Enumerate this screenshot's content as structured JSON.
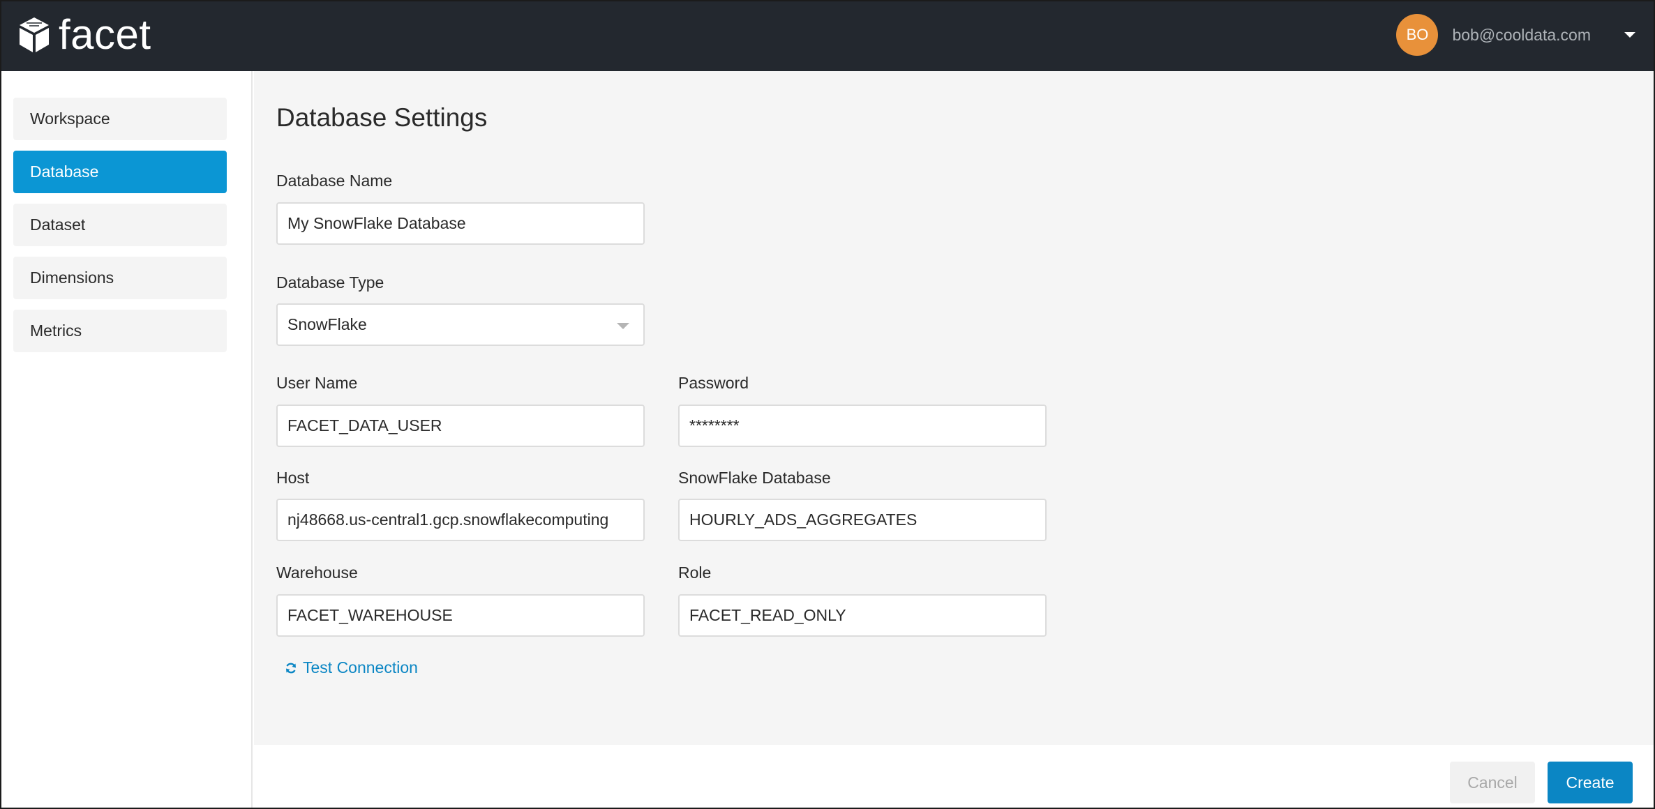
{
  "header": {
    "logo_text": "facet",
    "avatar_initials": "BO",
    "user_email": "bob@cooldata.com"
  },
  "sidebar": {
    "items": [
      {
        "label": "Workspace",
        "active": false
      },
      {
        "label": "Database",
        "active": true
      },
      {
        "label": "Dataset",
        "active": false
      },
      {
        "label": "Dimensions",
        "active": false
      },
      {
        "label": "Metrics",
        "active": false
      }
    ]
  },
  "main": {
    "title": "Database Settings",
    "fields": {
      "database_name": {
        "label": "Database Name",
        "value": "My SnowFlake Database"
      },
      "database_type": {
        "label": "Database Type",
        "value": "SnowFlake"
      },
      "user_name": {
        "label": "User Name",
        "value": "FACET_DATA_USER"
      },
      "password": {
        "label": "Password",
        "value": "********"
      },
      "host": {
        "label": "Host",
        "value": "nj48668.us-central1.gcp.snowflakecomputing"
      },
      "snowflake_database": {
        "label": "SnowFlake Database",
        "value": "HOURLY_ADS_AGGREGATES"
      },
      "warehouse": {
        "label": "Warehouse",
        "value": "FACET_WAREHOUSE"
      },
      "role": {
        "label": "Role",
        "value": "FACET_READ_ONLY"
      }
    },
    "test_connection_label": "Test Connection"
  },
  "footer": {
    "cancel_label": "Cancel",
    "create_label": "Create"
  },
  "colors": {
    "topbar": "#23282f",
    "accent": "#0b96d4",
    "avatar": "#e8913a"
  }
}
